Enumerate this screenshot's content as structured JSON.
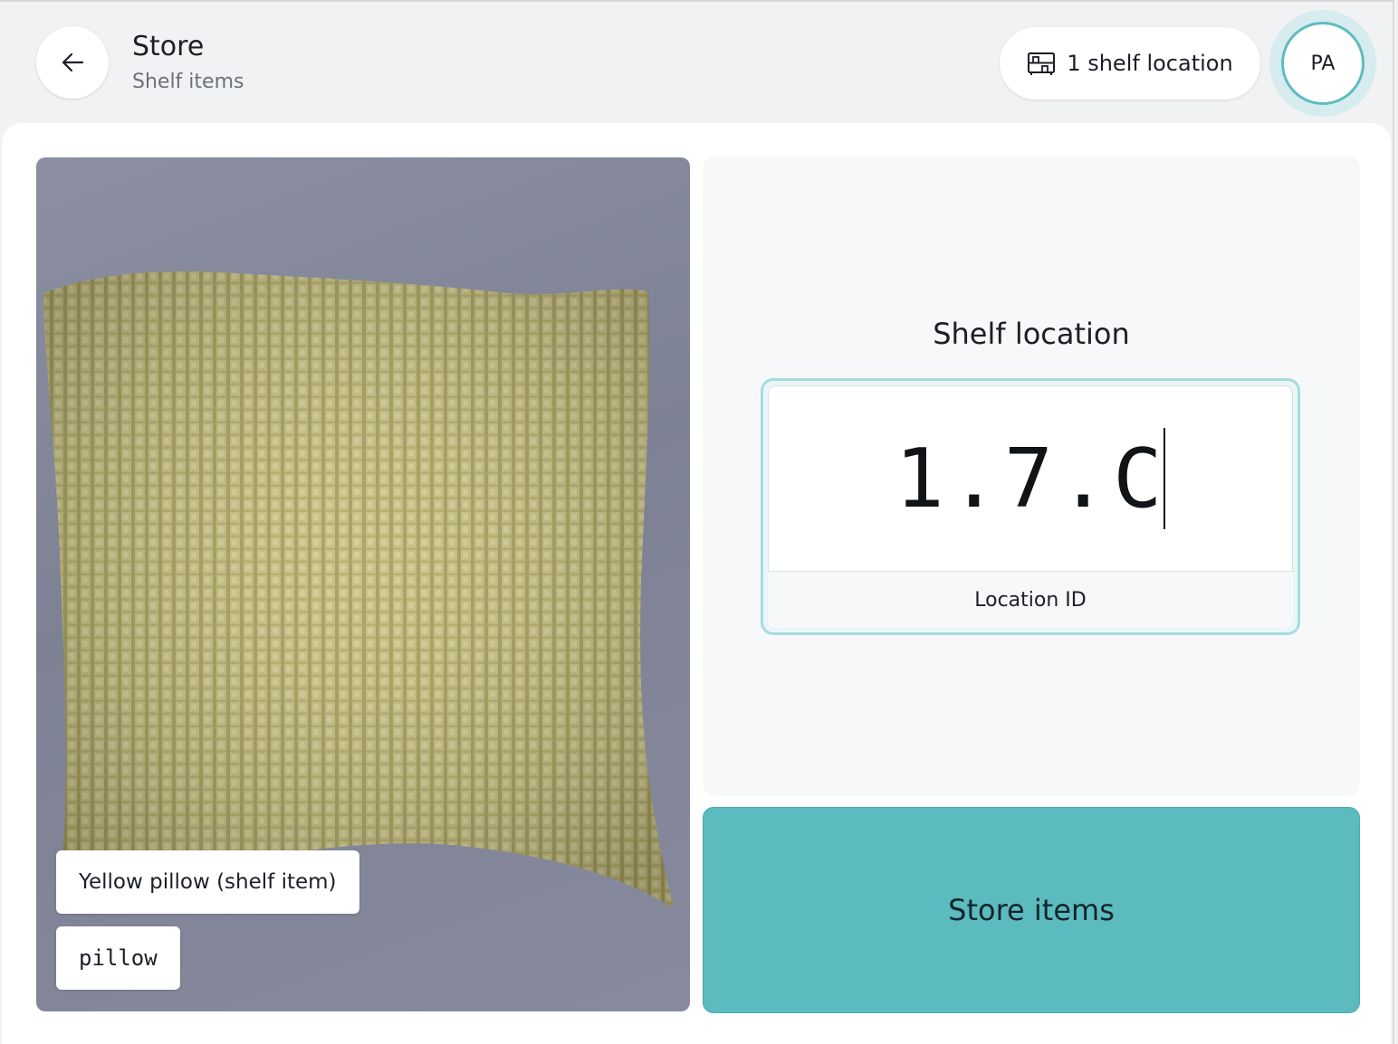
{
  "header": {
    "title": "Store",
    "subtitle": "Shelf items",
    "back_icon": "arrow-left-icon",
    "shelf_count_label": "1 shelf location",
    "shelf_icon": "shelf-icon",
    "avatar_initials": "PA"
  },
  "item": {
    "image_subject": "pillow",
    "label": "Yellow pillow (shelf item)",
    "code": "pillow"
  },
  "location": {
    "heading": "Shelf location",
    "value": "1.7.C",
    "caption": "Location ID"
  },
  "actions": {
    "store_label": "Store items"
  },
  "colors": {
    "accent": "#5bbbbf",
    "field_border": "#a7dcdf",
    "pillow": "#c3bb7c",
    "backdrop": "#84889a"
  }
}
